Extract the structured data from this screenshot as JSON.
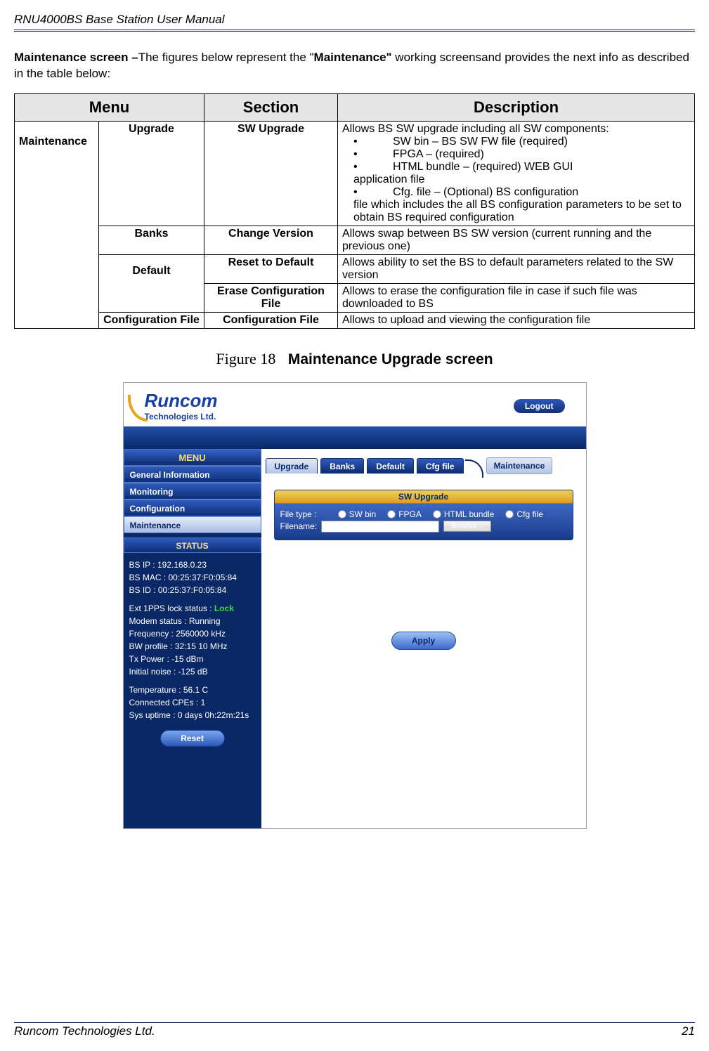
{
  "header": {
    "doc_title": "RNU4000BS Base Station User Manual"
  },
  "intro": {
    "lead_bold": "Maintenance screen –",
    "mid1": "The figures below represent the \"",
    "bold2": "Maintenance\"",
    "mid2": " working screensand provides the next info as described in the table below:"
  },
  "table": {
    "headers": {
      "menu": "Menu",
      "section": "Section",
      "desc": "Description"
    },
    "rows": {
      "menu_main": "Maintenance",
      "r1_sub": "Upgrade",
      "r1_sect": "SW Upgrade",
      "r1_desc_line1": "Allows BS SW upgrade including all SW components:",
      "r1_b1": "SW bin – BS SW FW file (required)",
      "r1_b2": "FPGA – (required)",
      "r1_b3": "HTML bundle – (required) WEB GUI",
      "r1_b3_tail": "application file",
      "r1_b4": "Cfg. file – (Optional) BS configuration",
      "r1_b4_tail": "file which includes the all BS configuration parameters to be set to obtain BS required configuration",
      "r2_sub": "Banks",
      "r2_sect": "Change Version",
      "r2_desc": "Allows swap between BS SW version (current running and the previous one)",
      "r3_sub": "Default",
      "r3_sect": "Reset to Default",
      "r3_desc": "Allows ability to set the BS to default parameters related to the SW version",
      "r4_sect": "Erase Configuration File",
      "r4_desc": "Allows to erase the configuration file in case if such file was downloaded to BS",
      "r5_sub": "Configuration File",
      "r5_sect": "Configuration File",
      "r5_desc": "Allows to upload and viewing the configuration file"
    }
  },
  "figure": {
    "num": "Figure 18",
    "title": "Maintenance Upgrade screen"
  },
  "screenshot": {
    "logo_main": "Runcom",
    "logo_sub": "Technologies Ltd.",
    "logout": "Logout",
    "sidebar": {
      "menu_hdr": "MENU",
      "items": [
        "General Information",
        "Monitoring",
        "Configuration",
        "Maintenance"
      ],
      "status_hdr": "STATUS",
      "status_lines": {
        "l1": "BS IP :  192.168.0.23",
        "l2": "BS MAC :  00:25:37:F0:05:84",
        "l3": "BS ID :  00:25:37:F0:05:84",
        "l4a": "Ext 1PPS lock status : ",
        "l4b": "Lock",
        "l5": "Modem status :  Running",
        "l6": "Frequency :  2560000 kHz",
        "l7": "BW profile :  32:15 10 MHz",
        "l8": "Tx Power :  -15 dBm",
        "l9": "Initial noise :  -125 dB",
        "l10": "Temperature :  56.1 C",
        "l11": "Connected CPEs :  1",
        "l12": "Sys uptime :  0 days 0h:22m:21s"
      },
      "reset": "Reset"
    },
    "tabs": [
      "Upgrade",
      "Banks",
      "Default",
      "Cfg file"
    ],
    "breadcrumb": "Maintenance",
    "panel": {
      "hdr": "SW Upgrade",
      "file_type_lbl": "File type :",
      "radios": [
        "SW bin",
        "FPGA",
        "HTML bundle",
        "Cfg file"
      ],
      "filename_lbl": "Filename:",
      "browse": "Browse...",
      "apply": "Apply"
    }
  },
  "footer": {
    "left": "Runcom Technologies Ltd.",
    "right": "21"
  }
}
